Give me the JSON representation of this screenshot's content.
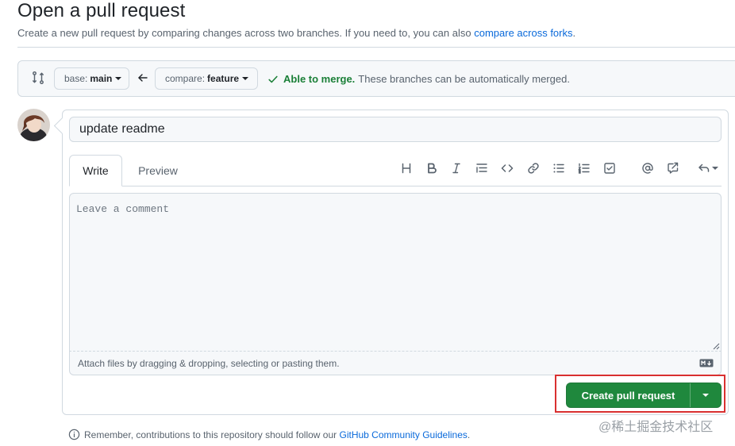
{
  "page": {
    "title": "Open a pull request",
    "subtitle": "Create a new pull request by comparing changes across two branches. If you need to, you can also",
    "subtitle_link": "compare across forks",
    "subtitle_end": "."
  },
  "compare": {
    "base_prefix": "base:",
    "base_branch": "main",
    "compare_prefix": "compare:",
    "compare_branch": "feature",
    "merge_status": "Able to merge.",
    "merge_detail": "These branches can be automatically merged."
  },
  "form": {
    "title_value": "update readme",
    "tabs": [
      "Write",
      "Preview"
    ],
    "comment_placeholder": "Leave a comment",
    "attach_hint": "Attach files by dragging & dropping, selecting or pasting them.",
    "submit_label": "Create pull request"
  },
  "footer": {
    "note": "Remember, contributions to this repository should follow our",
    "link": "GitHub Community Guidelines",
    "end": "."
  },
  "watermark": "@稀土掘金技术社区",
  "colors": {
    "accent_link": "#0969da",
    "success": "#1a7f37",
    "primary_button": "#1f883d",
    "highlight": "#d93030"
  },
  "icons": {
    "toolbar": [
      "heading-icon",
      "bold-icon",
      "italic-icon",
      "quote-icon",
      "code-icon",
      "link-icon",
      "unordered-list-icon",
      "ordered-list-icon",
      "task-list-icon",
      "mention-icon",
      "reference-icon",
      "reply-icon"
    ]
  }
}
